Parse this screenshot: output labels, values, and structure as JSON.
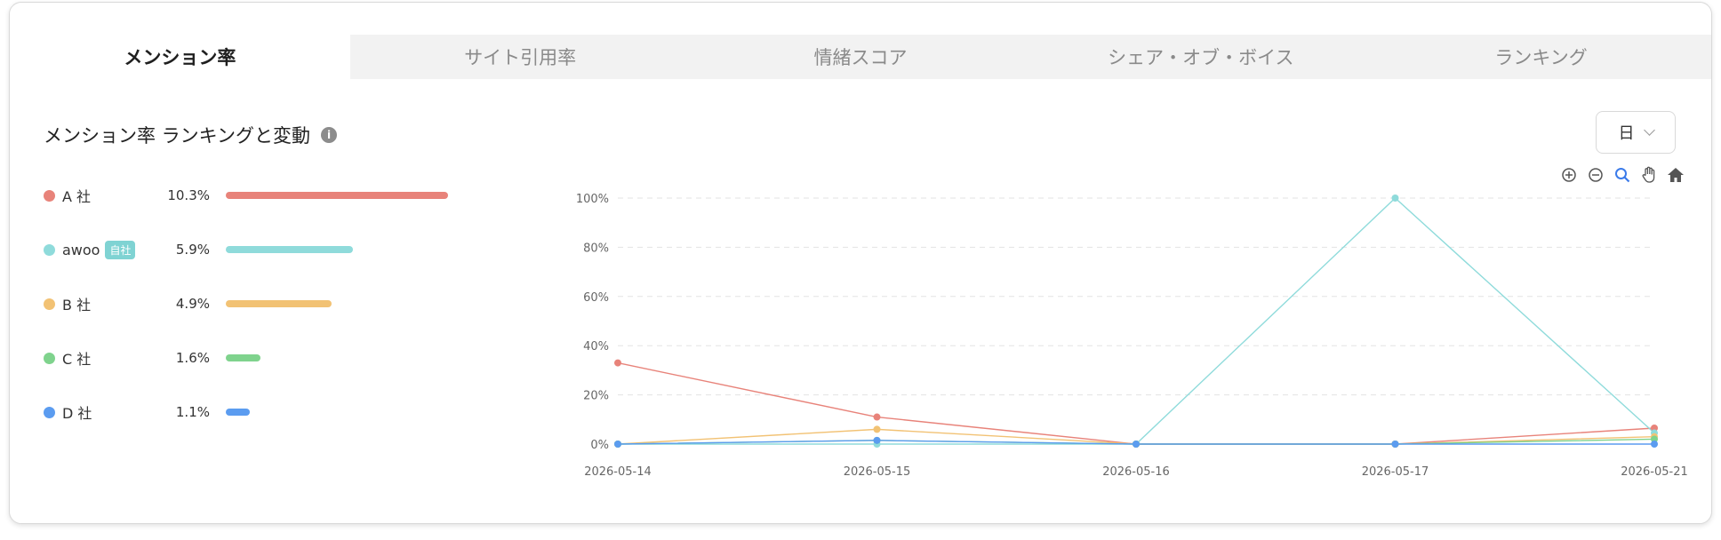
{
  "tabs": [
    {
      "label": "メンション率",
      "active": true
    },
    {
      "label": "サイト引用率",
      "active": false
    },
    {
      "label": "情緒スコア",
      "active": false
    },
    {
      "label": "シェア・オブ・ボイス",
      "active": false
    },
    {
      "label": "ランキング",
      "active": false
    }
  ],
  "section": {
    "title": "メンション率 ランキングと変動",
    "info_icon": "info-icon"
  },
  "period_select": {
    "value": "日"
  },
  "ranking": [
    {
      "name": "A 社",
      "pct": "10.3%",
      "value": 10.3,
      "color": "#e8837a",
      "badge": ""
    },
    {
      "name": "awoo",
      "pct": "5.9%",
      "value": 5.9,
      "color": "#8fdbdb",
      "badge": "自社"
    },
    {
      "name": "B 社",
      "pct": "4.9%",
      "value": 4.9,
      "color": "#f2c274",
      "badge": ""
    },
    {
      "name": "C 社",
      "pct": "1.6%",
      "value": 1.6,
      "color": "#7fd38d",
      "badge": ""
    },
    {
      "name": "D 社",
      "pct": "1.1%",
      "value": 1.1,
      "color": "#5b9cf0",
      "badge": ""
    }
  ],
  "toolbar": [
    "zoom-in-icon",
    "zoom-out-icon",
    "magnifier-icon",
    "hand-pan-icon",
    "home-icon"
  ],
  "chart_data": {
    "type": "line",
    "x": [
      "2026-05-14",
      "2026-05-15",
      "2026-05-16",
      "2026-05-17",
      "2026-05-21"
    ],
    "ylim": [
      0,
      100
    ],
    "yticks": [
      "0%",
      "20%",
      "40%",
      "60%",
      "80%",
      "100%"
    ],
    "grid": true,
    "series": [
      {
        "name": "A 社",
        "color": "#e8837a",
        "values": [
          33,
          11,
          0,
          0,
          6.5
        ]
      },
      {
        "name": "awoo",
        "color": "#8fdbdb",
        "values": [
          0,
          0,
          0,
          100,
          4.5
        ]
      },
      {
        "name": "B 社",
        "color": "#f2c274",
        "values": [
          0,
          6,
          0,
          0,
          3
        ]
      },
      {
        "name": "C 社",
        "color": "#7fd38d",
        "values": [
          0,
          1.5,
          0,
          0,
          2
        ]
      },
      {
        "name": "D 社",
        "color": "#5b9cf0",
        "values": [
          0,
          1.5,
          0,
          0,
          0
        ]
      }
    ]
  }
}
